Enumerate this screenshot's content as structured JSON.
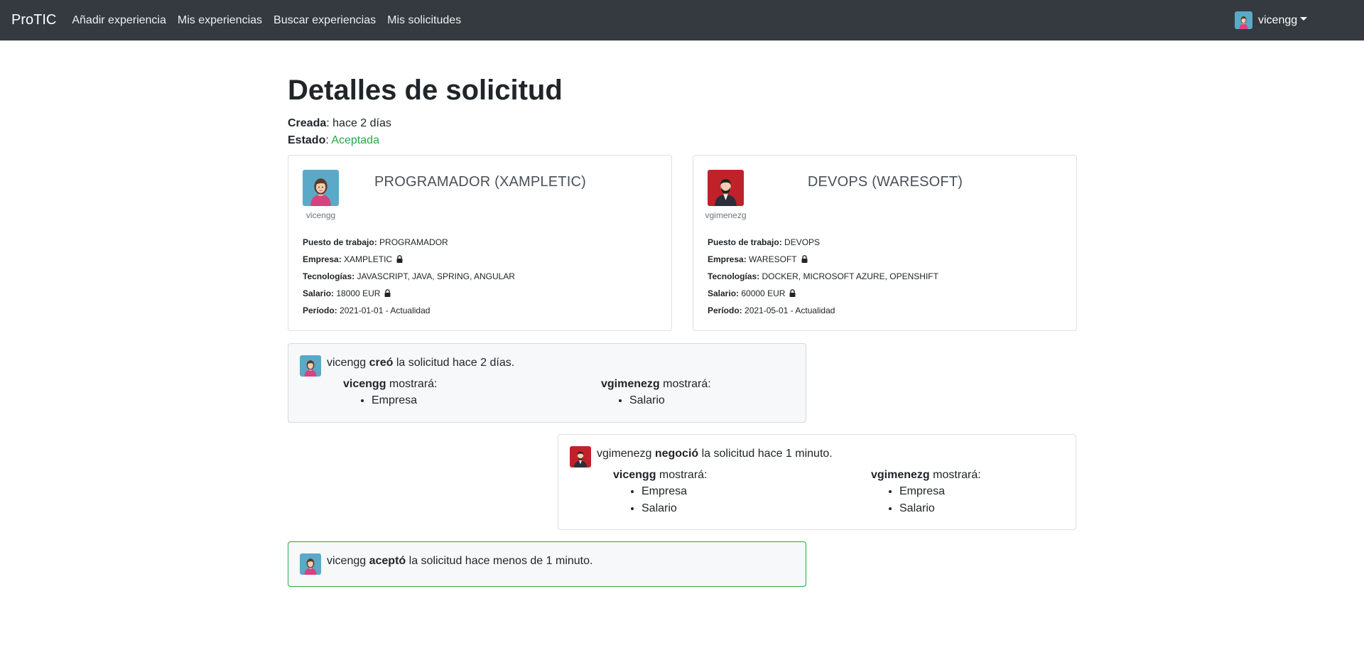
{
  "nav": {
    "brand": "ProTIC",
    "links": [
      "Añadir experiencia",
      "Mis experiencias",
      "Buscar experiencias",
      "Mis solicitudes"
    ],
    "user": "vicengg"
  },
  "page": {
    "title": "Detalles de solicitud",
    "created_label": "Creada",
    "created_value": ": hace 2 días",
    "status_label": "Estado",
    "status_sep": ": ",
    "status_value": "Aceptada"
  },
  "cards": [
    {
      "username": "vicengg",
      "title": "PROGRAMADOR (XAMPLETIC)",
      "puesto_label": "Puesto de trabajo:",
      "puesto": "PROGRAMADOR",
      "empresa_label": "Empresa:",
      "empresa": "XAMPLETIC",
      "tecnologias_label": "Tecnologías:",
      "tecnologias": "JAVASCRIPT, JAVA, SPRING, ANGULAR",
      "salario_label": "Salario:",
      "salario": "18000 EUR",
      "periodo_label": "Período:",
      "periodo": "2021-01-01 - Actualidad"
    },
    {
      "username": "vgimenezg",
      "title": "DEVOPS (WARESOFT)",
      "puesto_label": "Puesto de trabajo:",
      "puesto": "DEVOPS",
      "empresa_label": "Empresa:",
      "empresa": "WARESOFT",
      "tecnologias_label": "Tecnologías:",
      "tecnologias": "DOCKER, MICROSOFT AZURE, OPENSHIFT",
      "salario_label": "Salario:",
      "salario": "60000 EUR",
      "periodo_label": "Período:",
      "periodo": "2021-05-01 - Actualidad"
    }
  ],
  "events": [
    {
      "user": "vicengg",
      "action": "creó",
      "rest": "la solicitud hace 2 días.",
      "left_user": "vicengg",
      "right_user": "vgimenezg",
      "shows_label": "mostrará:",
      "left_items": [
        "Empresa"
      ],
      "right_items": [
        "Salario"
      ]
    },
    {
      "user": "vgimenezg",
      "action": "negoció",
      "rest": "la solicitud hace 1 minuto.",
      "left_user": "vicengg",
      "right_user": "vgimenezg",
      "shows_label": "mostrará:",
      "left_items": [
        "Empresa",
        "Salario"
      ],
      "right_items": [
        "Empresa",
        "Salario"
      ]
    },
    {
      "user": "vicengg",
      "action": "aceptó",
      "rest": "la solicitud hace menos de 1 minuto."
    }
  ],
  "colors": {
    "navbar": "#343a40",
    "success": "#28a745",
    "avatar_female_bg": "#5aa9c8",
    "avatar_male_bg": "#c0222a"
  }
}
